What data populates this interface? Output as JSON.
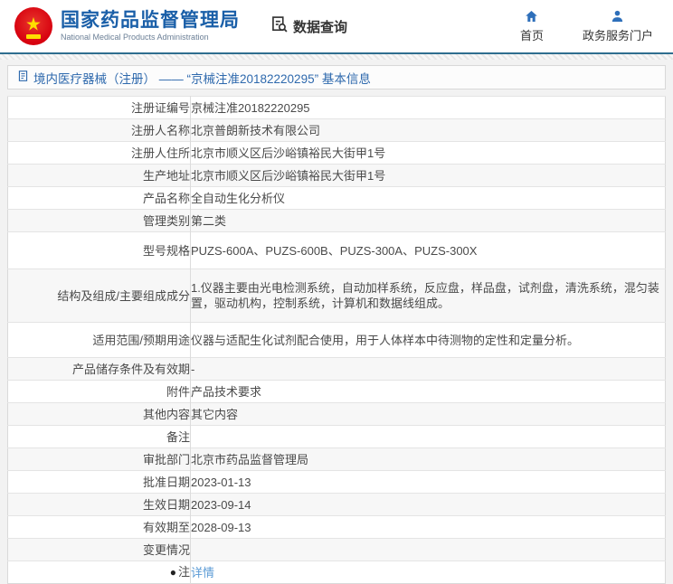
{
  "header": {
    "logo": {
      "emblem_icon": "china-national-emblem-icon",
      "title": "国家药品监督管理局",
      "subtitle": "National Medical Products Administration"
    },
    "data_query": {
      "icon": "document-search-icon",
      "label": "数据查询"
    },
    "nav": [
      {
        "icon": "home-icon",
        "label": "首页"
      },
      {
        "icon": "person-icon",
        "label": "政务服务门户"
      }
    ]
  },
  "breadcrumb": {
    "icon": "document-icon",
    "text": "境内医疗器械（注册） —— “京械注准20182220295” 基本信息"
  },
  "table": {
    "rows": [
      {
        "label": "注册证编号",
        "value": "京械注准20182220295"
      },
      {
        "label": "注册人名称",
        "value": "北京普朗新技术有限公司"
      },
      {
        "label": "注册人住所",
        "value": "北京市顺义区后沙峪镇裕民大街甲1号"
      },
      {
        "label": "生产地址",
        "value": "北京市顺义区后沙峪镇裕民大街甲1号"
      },
      {
        "label": "产品名称",
        "value": "全自动生化分析仪"
      },
      {
        "label": "管理类别",
        "value": "第二类"
      },
      {
        "label": "型号规格",
        "value": "PUZS-600A、PUZS-600B、PUZS-300A、PUZS-300X"
      },
      {
        "label": "结构及组成/主要组成成分",
        "value": "1.仪器主要由光电检测系统，自动加样系统，反应盘，样品盘，试剂盘，清洗系统，混匀装置，驱动机构，控制系统，计算机和数据线组成。"
      },
      {
        "label": "适用范围/预期用途",
        "value": "仪器与适配生化试剂配合使用，用于人体样本中待测物的定性和定量分析。"
      },
      {
        "label": "产品储存条件及有效期",
        "value": "-"
      },
      {
        "label": "附件",
        "value": "产品技术要求"
      },
      {
        "label": "其他内容",
        "value": "其它内容"
      },
      {
        "label": "备注",
        "value": ""
      },
      {
        "label": "审批部门",
        "value": "北京市药品监督管理局"
      },
      {
        "label": "批准日期",
        "value": "2023-01-13"
      },
      {
        "label": "生效日期",
        "value": "2023-09-14"
      },
      {
        "label": "有效期至",
        "value": "2028-09-13"
      },
      {
        "label": "变更情况",
        "value": ""
      },
      {
        "label": "注",
        "note_icon": true,
        "value": "详情",
        "value_is_link": true
      }
    ]
  },
  "colors": {
    "title_blue": "#1a5fa8",
    "breadcrumb_blue": "#2e69ad",
    "nav_icon_blue": "#2e6fba",
    "header_rule_teal": "#2f6e8f",
    "emblem_red": "#d7000f",
    "emblem_gold": "#ffde00",
    "link_blue": "#5b9bd5",
    "row_alt_bg": "#f7f7f7",
    "border_gray": "#d9d9d9"
  }
}
